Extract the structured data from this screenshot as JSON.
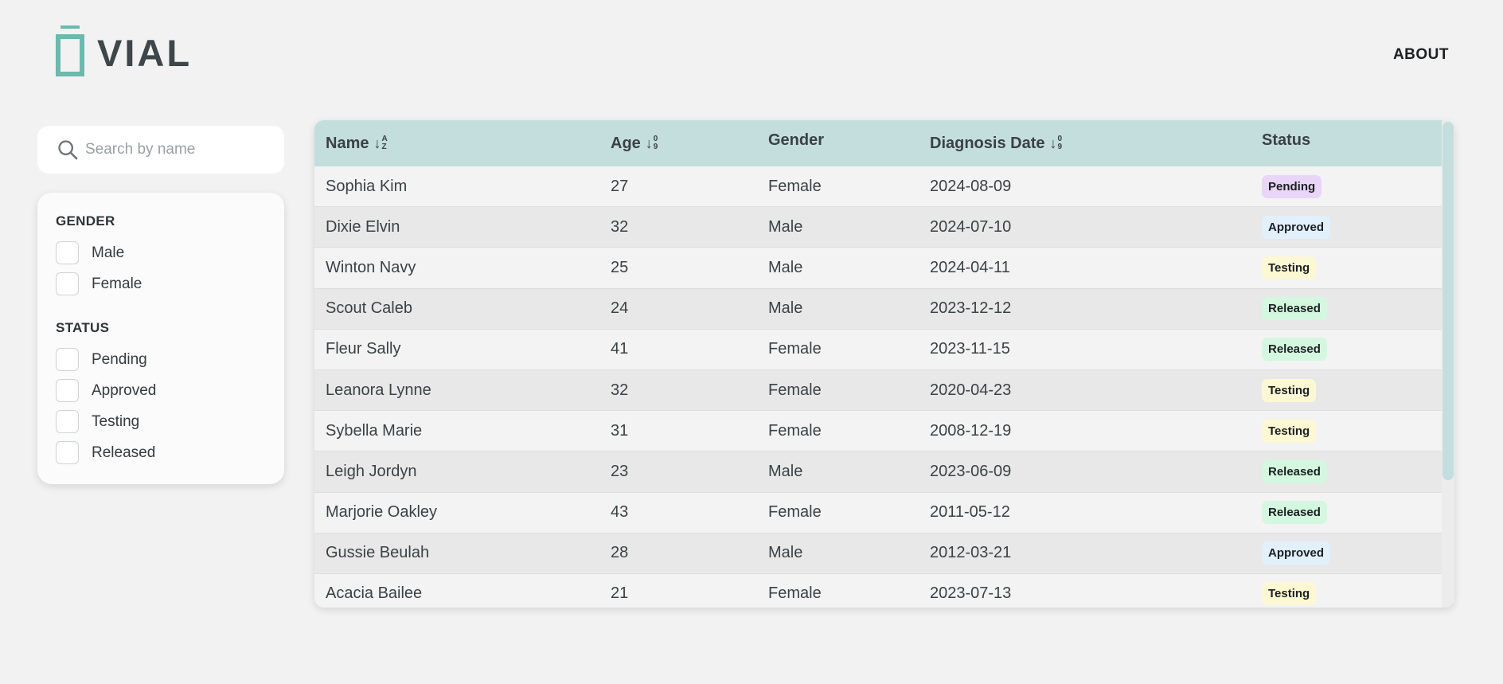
{
  "app": {
    "name": "VIAL",
    "nav_about": "ABOUT"
  },
  "search": {
    "placeholder": "Search by name",
    "value": ""
  },
  "filters": {
    "gender_heading": "GENDER",
    "gender_options": [
      "Male",
      "Female"
    ],
    "status_heading": "STATUS",
    "status_options": [
      "Pending",
      "Approved",
      "Testing",
      "Released"
    ]
  },
  "table": {
    "columns": [
      "Name",
      "Age",
      "Gender",
      "Diagnosis Date",
      "Status"
    ],
    "sort_glyphs": {
      "alpha": [
        "A",
        "Z"
      ],
      "numeric": [
        "0",
        "9"
      ]
    },
    "rows": [
      {
        "name": "Sophia Kim",
        "age": "27",
        "gender": "Female",
        "date": "2024-08-09",
        "status": "Pending"
      },
      {
        "name": "Dixie Elvin",
        "age": "32",
        "gender": "Male",
        "date": "2024-07-10",
        "status": "Approved"
      },
      {
        "name": "Winton Navy",
        "age": "25",
        "gender": "Male",
        "date": "2024-04-11",
        "status": "Testing"
      },
      {
        "name": "Scout Caleb",
        "age": "24",
        "gender": "Male",
        "date": "2023-12-12",
        "status": "Released"
      },
      {
        "name": "Fleur Sally",
        "age": "41",
        "gender": "Female",
        "date": "2023-11-15",
        "status": "Released"
      },
      {
        "name": "Leanora Lynne",
        "age": "32",
        "gender": "Female",
        "date": "2020-04-23",
        "status": "Testing"
      },
      {
        "name": "Sybella Marie",
        "age": "31",
        "gender": "Female",
        "date": "2008-12-19",
        "status": "Testing"
      },
      {
        "name": "Leigh Jordyn",
        "age": "23",
        "gender": "Male",
        "date": "2023-06-09",
        "status": "Released"
      },
      {
        "name": "Marjorie Oakley",
        "age": "43",
        "gender": "Female",
        "date": "2011-05-12",
        "status": "Released"
      },
      {
        "name": "Gussie Beulah",
        "age": "28",
        "gender": "Male",
        "date": "2012-03-21",
        "status": "Approved"
      },
      {
        "name": "Acacia Bailee",
        "age": "21",
        "gender": "Female",
        "date": "2023-07-13",
        "status": "Testing"
      }
    ]
  },
  "colors": {
    "accent": "#6eb8ad",
    "header_bg": "#c4dedd",
    "status": {
      "Pending": "#e9d5f7",
      "Approved": "#e2effc",
      "Testing": "#fcf8d4",
      "Released": "#d4f7df"
    }
  }
}
